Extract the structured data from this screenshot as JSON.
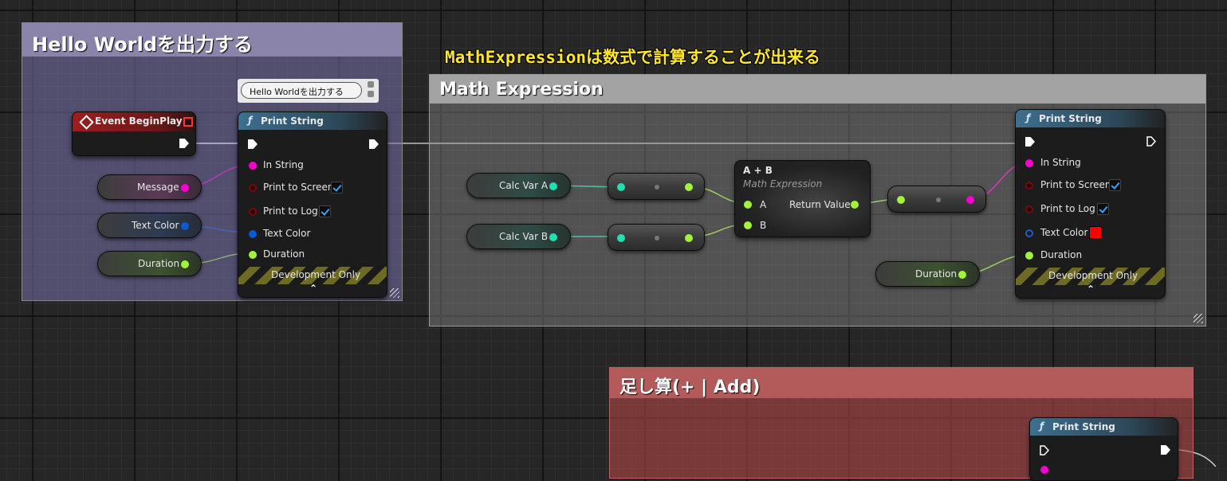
{
  "comments": {
    "hello": {
      "title": "Hello Worldを出力する"
    },
    "math": {
      "title": "Math Expression"
    },
    "add": {
      "title": "足し算(+ | Add)"
    }
  },
  "annotation": "MathExpressionは数式で計算することが出来る",
  "bubble": {
    "text": "Hello Worldを出力する"
  },
  "event_node": {
    "title": "Event BeginPlay"
  },
  "print_string_1": {
    "title": "Print String",
    "in_string": "In String",
    "print_to_screen": "Print to Screen",
    "print_to_log": "Print to Log",
    "text_color": "Text Color",
    "duration": "Duration",
    "dev_only": "Development Only"
  },
  "variables_left": {
    "message": "Message",
    "text_color": "Text Color",
    "duration": "Duration"
  },
  "math_vars": {
    "a": "Calc Var A",
    "b": "Calc Var B",
    "duration": "Duration"
  },
  "math_node": {
    "title": "A + B",
    "subtitle": "Math Expression",
    "pin_a": "A",
    "pin_b": "B",
    "return_value": "Return Value"
  },
  "print_string_2": {
    "title": "Print String",
    "in_string": "In String",
    "print_to_screen": "Print to Screen",
    "print_to_log": "Print to Log",
    "text_color": "Text Color",
    "duration": "Duration",
    "dev_only": "Development Only"
  },
  "print_string_3": {
    "title": "Print String"
  },
  "colors": {
    "exec": "#ffffff",
    "string": "#fb00d1",
    "float": "#a3f33a",
    "color_struct": "#0a5ad2",
    "int": "#1fe0b2",
    "text_color_swatch": "#ff0000"
  },
  "icons": [
    "function-icon",
    "event-diamond-icon",
    "exec-pin-icon",
    "checkbox-icon",
    "resize-grip-icon",
    "expand-chevron-icon"
  ]
}
